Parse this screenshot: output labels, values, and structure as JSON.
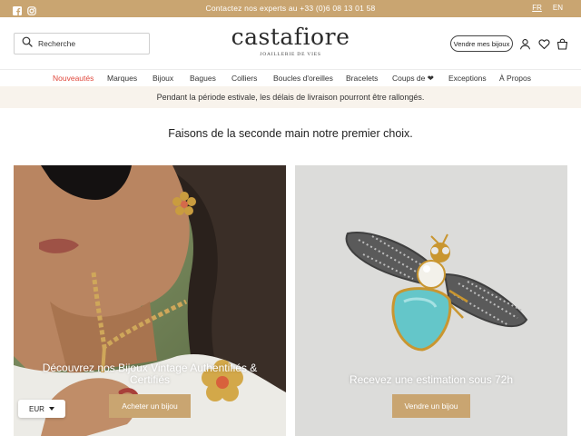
{
  "topbar": {
    "contact": "Contactez nos experts au +33 (0)6 08 13 01 58",
    "icons": [
      "facebook-icon",
      "instagram-icon"
    ],
    "languages": [
      {
        "label": "FR",
        "active": true
      },
      {
        "label": "EN",
        "active": false
      }
    ]
  },
  "header": {
    "search_placeholder": "Recherche",
    "logo_name": "castafiore",
    "logo_tag": "JOAILLERIE DE VIES",
    "sell_button": "Vendre mes bijoux",
    "icons": [
      "account-icon",
      "wishlist-heart-icon",
      "cart-icon"
    ]
  },
  "nav": [
    {
      "label": "Nouveautés",
      "accent": true
    },
    {
      "label": "Marques"
    },
    {
      "label": "Bijoux"
    },
    {
      "label": "Bagues"
    },
    {
      "label": "Colliers"
    },
    {
      "label": "Boucles d'oreilles"
    },
    {
      "label": "Bracelets"
    },
    {
      "label": "Coups de ❤"
    },
    {
      "label": "Exceptions"
    },
    {
      "label": "À Propos"
    }
  ],
  "notice": "Pendant la période estivale, les délais de livraison pourront être rallongés.",
  "tagline": "Faisons de la seconde main notre premier choix.",
  "cards": [
    {
      "title": "Découvrez nos Bijoux Vintage Authentifiés & Certifiés",
      "button": "Acheter un bijou"
    },
    {
      "title": "Recevez une estimation sous 72h",
      "button": "Vendre un bijou"
    }
  ],
  "currency": "EUR",
  "colors": {
    "gold": "#c9a571",
    "accent": "#e0473b",
    "notice_bg": "#f8f3ec"
  }
}
